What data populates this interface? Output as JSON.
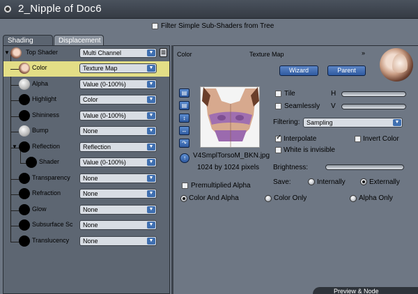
{
  "window": {
    "title": "2_Nipple of Doc6"
  },
  "filter": {
    "label": "Filter Simple Sub-Shaders from Tree",
    "checked": false
  },
  "tabs": [
    {
      "label": "Shading",
      "active": true
    },
    {
      "label": "Displacement",
      "active": false
    }
  ],
  "tree": [
    {
      "label": "Top Shader",
      "value": "Multi Channel",
      "ball": "texture",
      "selected": false
    },
    {
      "label": "Color",
      "value": "Texture Map",
      "ball": "texture",
      "selected": true
    },
    {
      "label": "Alpha",
      "value": "Value (0-100%)",
      "ball": "grey",
      "selected": false
    },
    {
      "label": "Highlight",
      "value": "Color",
      "ball": "black",
      "selected": false
    },
    {
      "label": "Shininess",
      "value": "Value (0-100%)",
      "ball": "black",
      "selected": false
    },
    {
      "label": "Bump",
      "value": "None",
      "ball": "grey",
      "selected": false
    },
    {
      "label": "Reflection",
      "value": "Reflection",
      "ball": "black",
      "selected": false
    },
    {
      "label": "Shader",
      "value": "Value (0-100%)",
      "ball": "black",
      "selected": false
    },
    {
      "label": "Transparency",
      "value": "None",
      "ball": "black",
      "selected": false
    },
    {
      "label": "Refraction",
      "value": "None",
      "ball": "black",
      "selected": false
    },
    {
      "label": "Glow",
      "value": "None",
      "ball": "black",
      "selected": false
    },
    {
      "label": "Subsurface Sc",
      "value": "None",
      "ball": "black",
      "selected": false
    },
    {
      "label": "Translucency",
      "value": "None",
      "ball": "black",
      "selected": false
    }
  ],
  "editor": {
    "channel_label": "Color",
    "shader_type": "Texture Map",
    "chevron": "»",
    "wizard_label": "Wizard",
    "parent_label": "Parent",
    "filename": "V4SmplTorsoM_BKN.jpg",
    "dimensions": "1024 by 1024 pixels",
    "tile_label": "Tile",
    "tile_checked": false,
    "seamless_label": "Seamlessly",
    "seamless_checked": false,
    "h_label": "H",
    "v_label": "V",
    "filtering_label": "Filtering:",
    "filtering_value": "Sampling",
    "interpolate_label": "Interpolate",
    "interpolate_checked": true,
    "invert_color_label": "Invert Color",
    "invert_color_checked": false,
    "white_invisible_label": "White is invisible",
    "white_invisible_checked": false,
    "brightness_label": "Brightness:",
    "premultiplied_label": "Premultiplied Alpha",
    "premultiplied_checked": false,
    "save_label": "Save:",
    "save_options": [
      "Internally",
      "Externally"
    ],
    "save_selected": "Externally",
    "mode_options": [
      "Color And Alpha",
      "Color Only",
      "Alpha Only"
    ],
    "mode_selected": "Color And Alpha"
  },
  "bottom_tab": {
    "label": "Preview & Node"
  }
}
